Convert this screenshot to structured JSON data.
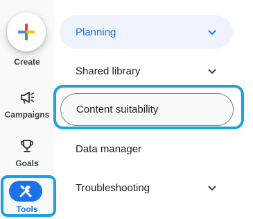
{
  "rail": {
    "create_label": "Create",
    "campaigns_label": "Campaigns",
    "goals_label": "Goals",
    "tools_label": "Tools"
  },
  "menu": {
    "items": [
      {
        "label": "Planning",
        "expanded": true
      },
      {
        "label": "Shared library"
      },
      {
        "label": "Content suitability",
        "selected": true
      },
      {
        "label": "Data manager"
      },
      {
        "label": "Troubleshooting"
      }
    ]
  },
  "colors": {
    "accent": "#1a73e8",
    "highlight_outline": "#1aa3e0",
    "planning_bg": "#eef3fd"
  },
  "icons": [
    "plus-icon",
    "megaphone-icon",
    "trophy-icon",
    "tools-icon",
    "chevron-down-icon"
  ]
}
